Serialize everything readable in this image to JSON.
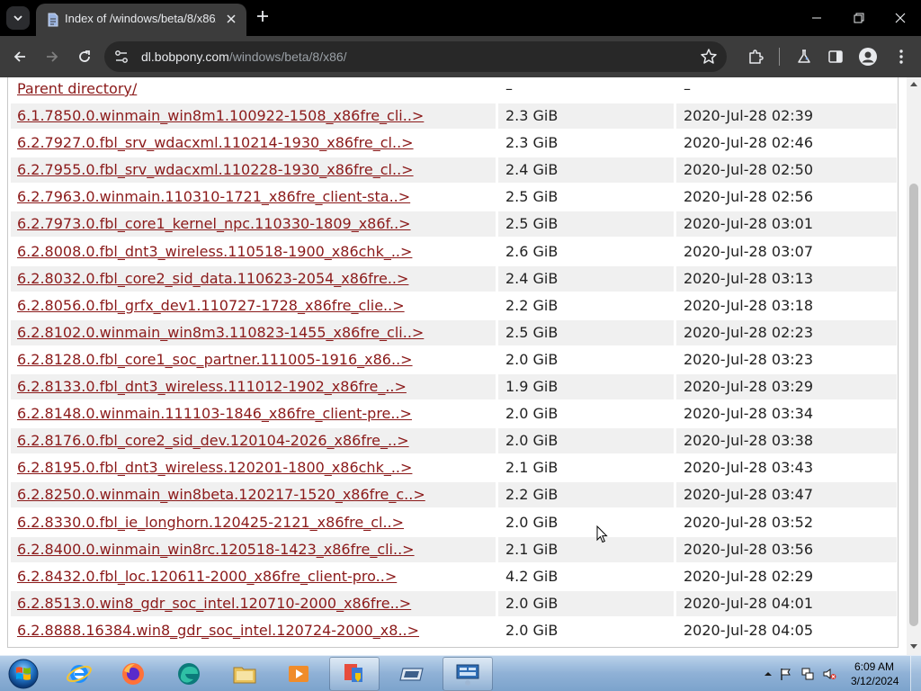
{
  "browser": {
    "tab": {
      "title": "Index of /windows/beta/8/x86/"
    },
    "omnibox": {
      "host": "dl.bobpony.com",
      "path": "/windows/beta/8/x86/"
    }
  },
  "listing": {
    "parent": {
      "name": "Parent directory/",
      "size": "–",
      "date": "–"
    },
    "rows": [
      {
        "name": "6.1.7850.0.winmain_win8m1.100922-1508_x86fre_cli..>",
        "size": "2.3 GiB",
        "date": "2020-Jul-28 02:39"
      },
      {
        "name": "6.2.7927.0.fbl_srv_wdacxml.110214-1930_x86fre_cl..>",
        "size": "2.3 GiB",
        "date": "2020-Jul-28 02:46"
      },
      {
        "name": "6.2.7955.0.fbl_srv_wdacxml.110228-1930_x86fre_cl..>",
        "size": "2.4 GiB",
        "date": "2020-Jul-28 02:50"
      },
      {
        "name": "6.2.7963.0.winmain.110310-1721_x86fre_client-sta..>",
        "size": "2.5 GiB",
        "date": "2020-Jul-28 02:56"
      },
      {
        "name": "6.2.7973.0.fbl_core1_kernel_npc.110330-1809_x86f..>",
        "size": "2.5 GiB",
        "date": "2020-Jul-28 03:01"
      },
      {
        "name": "6.2.8008.0.fbl_dnt3_wireless.110518-1900_x86chk_..>",
        "size": "2.6 GiB",
        "date": "2020-Jul-28 03:07"
      },
      {
        "name": "6.2.8032.0.fbl_core2_sid_data.110623-2054_x86fre..>",
        "size": "2.4 GiB",
        "date": "2020-Jul-28 03:13"
      },
      {
        "name": "6.2.8056.0.fbl_grfx_dev1.110727-1728_x86fre_clie..>",
        "size": "2.2 GiB",
        "date": "2020-Jul-28 03:18"
      },
      {
        "name": "6.2.8102.0.winmain_win8m3.110823-1455_x86fre_cli..>",
        "size": "2.5 GiB",
        "date": "2020-Jul-28 02:23"
      },
      {
        "name": "6.2.8128.0.fbl_core1_soc_partner.111005-1916_x86..>",
        "size": "2.0 GiB",
        "date": "2020-Jul-28 03:23"
      },
      {
        "name": "6.2.8133.0.fbl_dnt3_wireless.111012-1902_x86fre_..>",
        "size": "1.9 GiB",
        "date": "2020-Jul-28 03:29"
      },
      {
        "name": "6.2.8148.0.winmain.111103-1846_x86fre_client-pre..>",
        "size": "2.0 GiB",
        "date": "2020-Jul-28 03:34"
      },
      {
        "name": "6.2.8176.0.fbl_core2_sid_dev.120104-2026_x86fre_..>",
        "size": "2.0 GiB",
        "date": "2020-Jul-28 03:38"
      },
      {
        "name": "6.2.8195.0.fbl_dnt3_wireless.120201-1800_x86chk_..>",
        "size": "2.1 GiB",
        "date": "2020-Jul-28 03:43"
      },
      {
        "name": "6.2.8250.0.winmain_win8beta.120217-1520_x86fre_c..>",
        "size": "2.2 GiB",
        "date": "2020-Jul-28 03:47"
      },
      {
        "name": "6.2.8330.0.fbl_ie_longhorn.120425-2121_x86fre_cl..>",
        "size": "2.0 GiB",
        "date": "2020-Jul-28 03:52"
      },
      {
        "name": "6.2.8400.0.winmain_win8rc.120518-1423_x86fre_cli..>",
        "size": "2.1 GiB",
        "date": "2020-Jul-28 03:56"
      },
      {
        "name": "6.2.8432.0.fbl_loc.120611-2000_x86fre_client-pro..>",
        "size": "4.2 GiB",
        "date": "2020-Jul-28 02:29"
      },
      {
        "name": "6.2.8513.0.win8_gdr_soc_intel.120710-2000_x86fre..>",
        "size": "2.0 GiB",
        "date": "2020-Jul-28 04:01"
      },
      {
        "name": "6.2.8888.16384.win8_gdr_soc_intel.120724-2000_x8..>",
        "size": "2.0 GiB",
        "date": "2020-Jul-28 04:05"
      }
    ]
  },
  "taskbar": {
    "apps": [
      "start-orb-icon",
      "internet-explorer-icon",
      "firefox-icon",
      "edge-icon",
      "file-explorer-icon",
      "media-player-icon",
      "control-panel-icon",
      "virtual-machine-icon",
      "remote-desktop-icon"
    ],
    "clock": {
      "time": "6:09 AM",
      "date": "3/12/2024"
    }
  },
  "colors": {
    "link": "#8b1a1a",
    "row_alt": "#f0f0f0",
    "browser_toolbar": "#3c3c3c",
    "tabstrip": "#000000"
  }
}
